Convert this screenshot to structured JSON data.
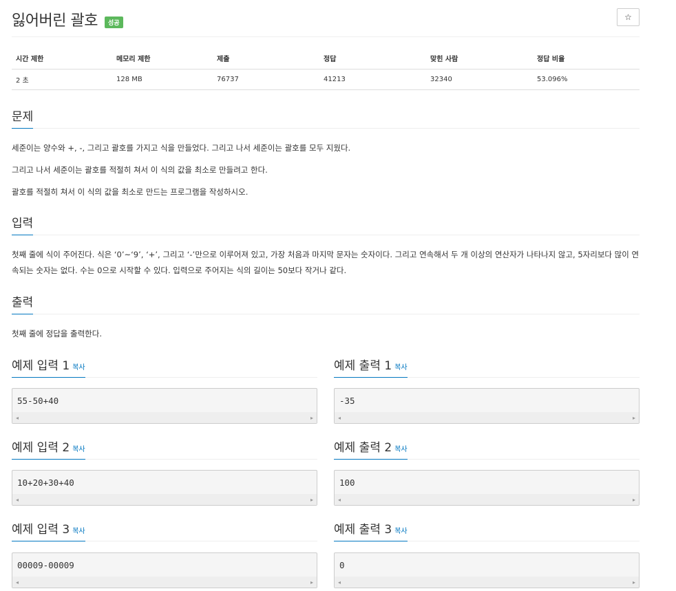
{
  "problem": {
    "title": "잃어버린 괄호",
    "badge": "성공",
    "star_icon": "☆"
  },
  "info": {
    "headers": [
      "시간 제한",
      "메모리 제한",
      "제출",
      "정답",
      "맞힌 사람",
      "정답 비율"
    ],
    "values": [
      "2 초",
      "128 MB",
      "76737",
      "41213",
      "32340",
      "53.096%"
    ]
  },
  "sections": {
    "problem_title": "문제",
    "problem_lines": [
      "세준이는 양수와 +, -, 그리고 괄호를 가지고 식을 만들었다. 그리고 나서 세준이는 괄호를 모두 지웠다.",
      "그리고 나서 세준이는 괄호를 적절히 쳐서 이 식의 값을 최소로 만들려고 한다.",
      "괄호를 적절히 쳐서 이 식의 값을 최소로 만드는 프로그램을 작성하시오."
    ],
    "input_title": "입력",
    "input_text": "첫째 줄에 식이 주어진다. 식은 ‘0’~‘9’, ‘+’, 그리고 ‘-’만으로 이루어져 있고, 가장 처음과 마지막 문자는 숫자이다. 그리고 연속해서 두 개 이상의 연산자가 나타나지 않고, 5자리보다 많이 연속되는 숫자는 없다. 수는 0으로 시작할 수 있다. 입력으로 주어지는 식의 길이는 50보다 작거나 같다.",
    "output_title": "출력",
    "output_text": "첫째 줄에 정답을 출력한다."
  },
  "copy_label": "복사",
  "samples": [
    {
      "in_title": "예제 입력 1",
      "in": "55-50+40",
      "out_title": "예제 출력 1",
      "out": "-35"
    },
    {
      "in_title": "예제 입력 2",
      "in": "10+20+30+40",
      "out_title": "예제 출력 2",
      "out": "100"
    },
    {
      "in_title": "예제 입력 3",
      "in": "00009-00009",
      "out_title": "예제 출력 3",
      "out": "0"
    }
  ],
  "colors": {
    "accent": "#0076c0",
    "badge": "#5cb85c"
  },
  "icons": {
    "scroll_left": "◂",
    "scroll_right": "▸"
  }
}
